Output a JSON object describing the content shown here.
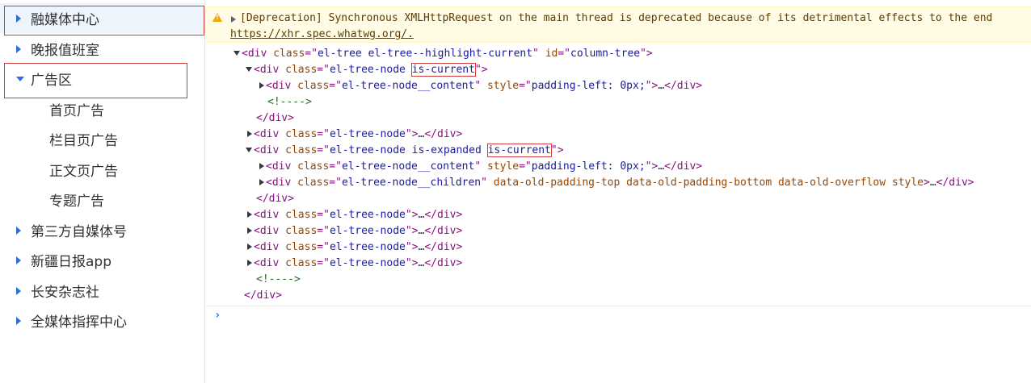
{
  "tree": {
    "items": [
      {
        "label": "融媒体中心",
        "arrow": "right",
        "level": 0
      },
      {
        "label": "晚报值班室",
        "arrow": "right",
        "level": 0
      },
      {
        "label": "广告区",
        "arrow": "down",
        "level": 0
      },
      {
        "label": "首页广告",
        "arrow": "",
        "level": 1
      },
      {
        "label": "栏目页广告",
        "arrow": "",
        "level": 1
      },
      {
        "label": "正文页广告",
        "arrow": "",
        "level": 1
      },
      {
        "label": "专题广告",
        "arrow": "",
        "level": 1
      },
      {
        "label": "第三方自媒体号",
        "arrow": "right",
        "level": 0
      },
      {
        "label": "新疆日报app",
        "arrow": "right",
        "level": 0
      },
      {
        "label": "长安杂志社",
        "arrow": "right",
        "level": 0
      },
      {
        "label": "全媒体指挥中心",
        "arrow": "right",
        "level": 0
      }
    ]
  },
  "console": {
    "warning": {
      "icon": "warning-icon",
      "text": "[Deprecation] Synchronous XMLHttpRequest on the main thread is deprecated because of its detrimental effects to the end",
      "link": "https://xhr.spec.whatwg.org/",
      "link_suffix": "."
    },
    "lines": [
      {
        "toggle": "down",
        "parts": [
          [
            "tag",
            "<div "
          ],
          [
            "attr",
            "class"
          ],
          [
            "tag",
            "=\""
          ],
          [
            "val",
            "el-tree el-tree--highlight-current"
          ],
          [
            "tag",
            "\" "
          ],
          [
            "attr",
            "id"
          ],
          [
            "tag",
            "=\""
          ],
          [
            "val",
            "column-tree"
          ],
          [
            "tag",
            "\">"
          ]
        ]
      },
      {
        "toggle": "down",
        "parts": [
          [
            "tag",
            "<div "
          ],
          [
            "attr",
            "class"
          ],
          [
            "tag",
            "=\""
          ],
          [
            "val",
            "el-tree-node "
          ],
          [
            "valbox",
            "is-current"
          ],
          [
            "tag",
            "\">"
          ]
        ]
      },
      {
        "toggle": "right",
        "parts": [
          [
            "tag",
            "<div "
          ],
          [
            "attr",
            "class"
          ],
          [
            "tag",
            "=\""
          ],
          [
            "val",
            "el-tree-node__content"
          ],
          [
            "tag",
            "\" "
          ],
          [
            "attr",
            "style"
          ],
          [
            "tag",
            "=\""
          ],
          [
            "val",
            "padding-left: 0px;"
          ],
          [
            "tag",
            "\">"
          ],
          [
            "ell",
            "…"
          ],
          [
            "tag",
            "</div>"
          ]
        ]
      },
      {
        "toggle": "",
        "parts": [
          [
            "comment",
            "<!---->"
          ]
        ]
      },
      {
        "toggle": "",
        "parts": [
          [
            "tag",
            "</div>"
          ]
        ]
      },
      {
        "toggle": "right",
        "parts": [
          [
            "tag",
            "<div "
          ],
          [
            "attr",
            "class"
          ],
          [
            "tag",
            "=\""
          ],
          [
            "val",
            "el-tree-node"
          ],
          [
            "tag",
            "\">"
          ],
          [
            "ell",
            "…"
          ],
          [
            "tag",
            "</div>"
          ]
        ]
      },
      {
        "toggle": "down",
        "parts": [
          [
            "tag",
            "<div "
          ],
          [
            "attr",
            "class"
          ],
          [
            "tag",
            "=\""
          ],
          [
            "val",
            "el-tree-node is-expanded "
          ],
          [
            "valbox",
            "is-current"
          ],
          [
            "tag",
            "\">"
          ]
        ]
      },
      {
        "toggle": "right",
        "parts": [
          [
            "tag",
            "<div "
          ],
          [
            "attr",
            "class"
          ],
          [
            "tag",
            "=\""
          ],
          [
            "val",
            "el-tree-node__content"
          ],
          [
            "tag",
            "\" "
          ],
          [
            "attr",
            "style"
          ],
          [
            "tag",
            "=\""
          ],
          [
            "val",
            "padding-left: 0px;"
          ],
          [
            "tag",
            "\">"
          ],
          [
            "ell",
            "…"
          ],
          [
            "tag",
            "</div>"
          ]
        ]
      },
      {
        "toggle": "right",
        "parts": [
          [
            "tag",
            "<div "
          ],
          [
            "attr",
            "class"
          ],
          [
            "tag",
            "=\""
          ],
          [
            "val",
            "el-tree-node__children"
          ],
          [
            "tag",
            "\" "
          ],
          [
            "attr",
            "data-old-padding-top data-old-padding-bottom data-old-overflow style"
          ],
          [
            "tag",
            ">"
          ],
          [
            "ell",
            "…"
          ],
          [
            "tag",
            "</div>"
          ]
        ]
      },
      {
        "toggle": "",
        "parts": [
          [
            "tag",
            "</div>"
          ]
        ]
      },
      {
        "toggle": "right",
        "parts": [
          [
            "tag",
            "<div "
          ],
          [
            "attr",
            "class"
          ],
          [
            "tag",
            "=\""
          ],
          [
            "val",
            "el-tree-node"
          ],
          [
            "tag",
            "\">"
          ],
          [
            "ell",
            "…"
          ],
          [
            "tag",
            "</div>"
          ]
        ]
      },
      {
        "toggle": "right",
        "parts": [
          [
            "tag",
            "<div "
          ],
          [
            "attr",
            "class"
          ],
          [
            "tag",
            "=\""
          ],
          [
            "val",
            "el-tree-node"
          ],
          [
            "tag",
            "\">"
          ],
          [
            "ell",
            "…"
          ],
          [
            "tag",
            "</div>"
          ]
        ]
      },
      {
        "toggle": "right",
        "parts": [
          [
            "tag",
            "<div "
          ],
          [
            "attr",
            "class"
          ],
          [
            "tag",
            "=\""
          ],
          [
            "val",
            "el-tree-node"
          ],
          [
            "tag",
            "\">"
          ],
          [
            "ell",
            "…"
          ],
          [
            "tag",
            "</div>"
          ]
        ]
      },
      {
        "toggle": "right",
        "parts": [
          [
            "tag",
            "<div "
          ],
          [
            "attr",
            "class"
          ],
          [
            "tag",
            "=\""
          ],
          [
            "val",
            "el-tree-node"
          ],
          [
            "tag",
            "\">"
          ],
          [
            "ell",
            "…"
          ],
          [
            "tag",
            "</div>"
          ]
        ]
      },
      {
        "toggle": "",
        "parts": [
          [
            "comment",
            "<!---->"
          ]
        ]
      },
      {
        "toggle": "",
        "parts": [
          [
            "tag",
            "</div>"
          ]
        ]
      }
    ],
    "prompt": "›"
  },
  "colors": {
    "tree_arrow": "#2e6ed6",
    "highlight_box": "#d23b3b",
    "current_bg": "#eef4fb",
    "warning_bg": "#fffbe5"
  }
}
